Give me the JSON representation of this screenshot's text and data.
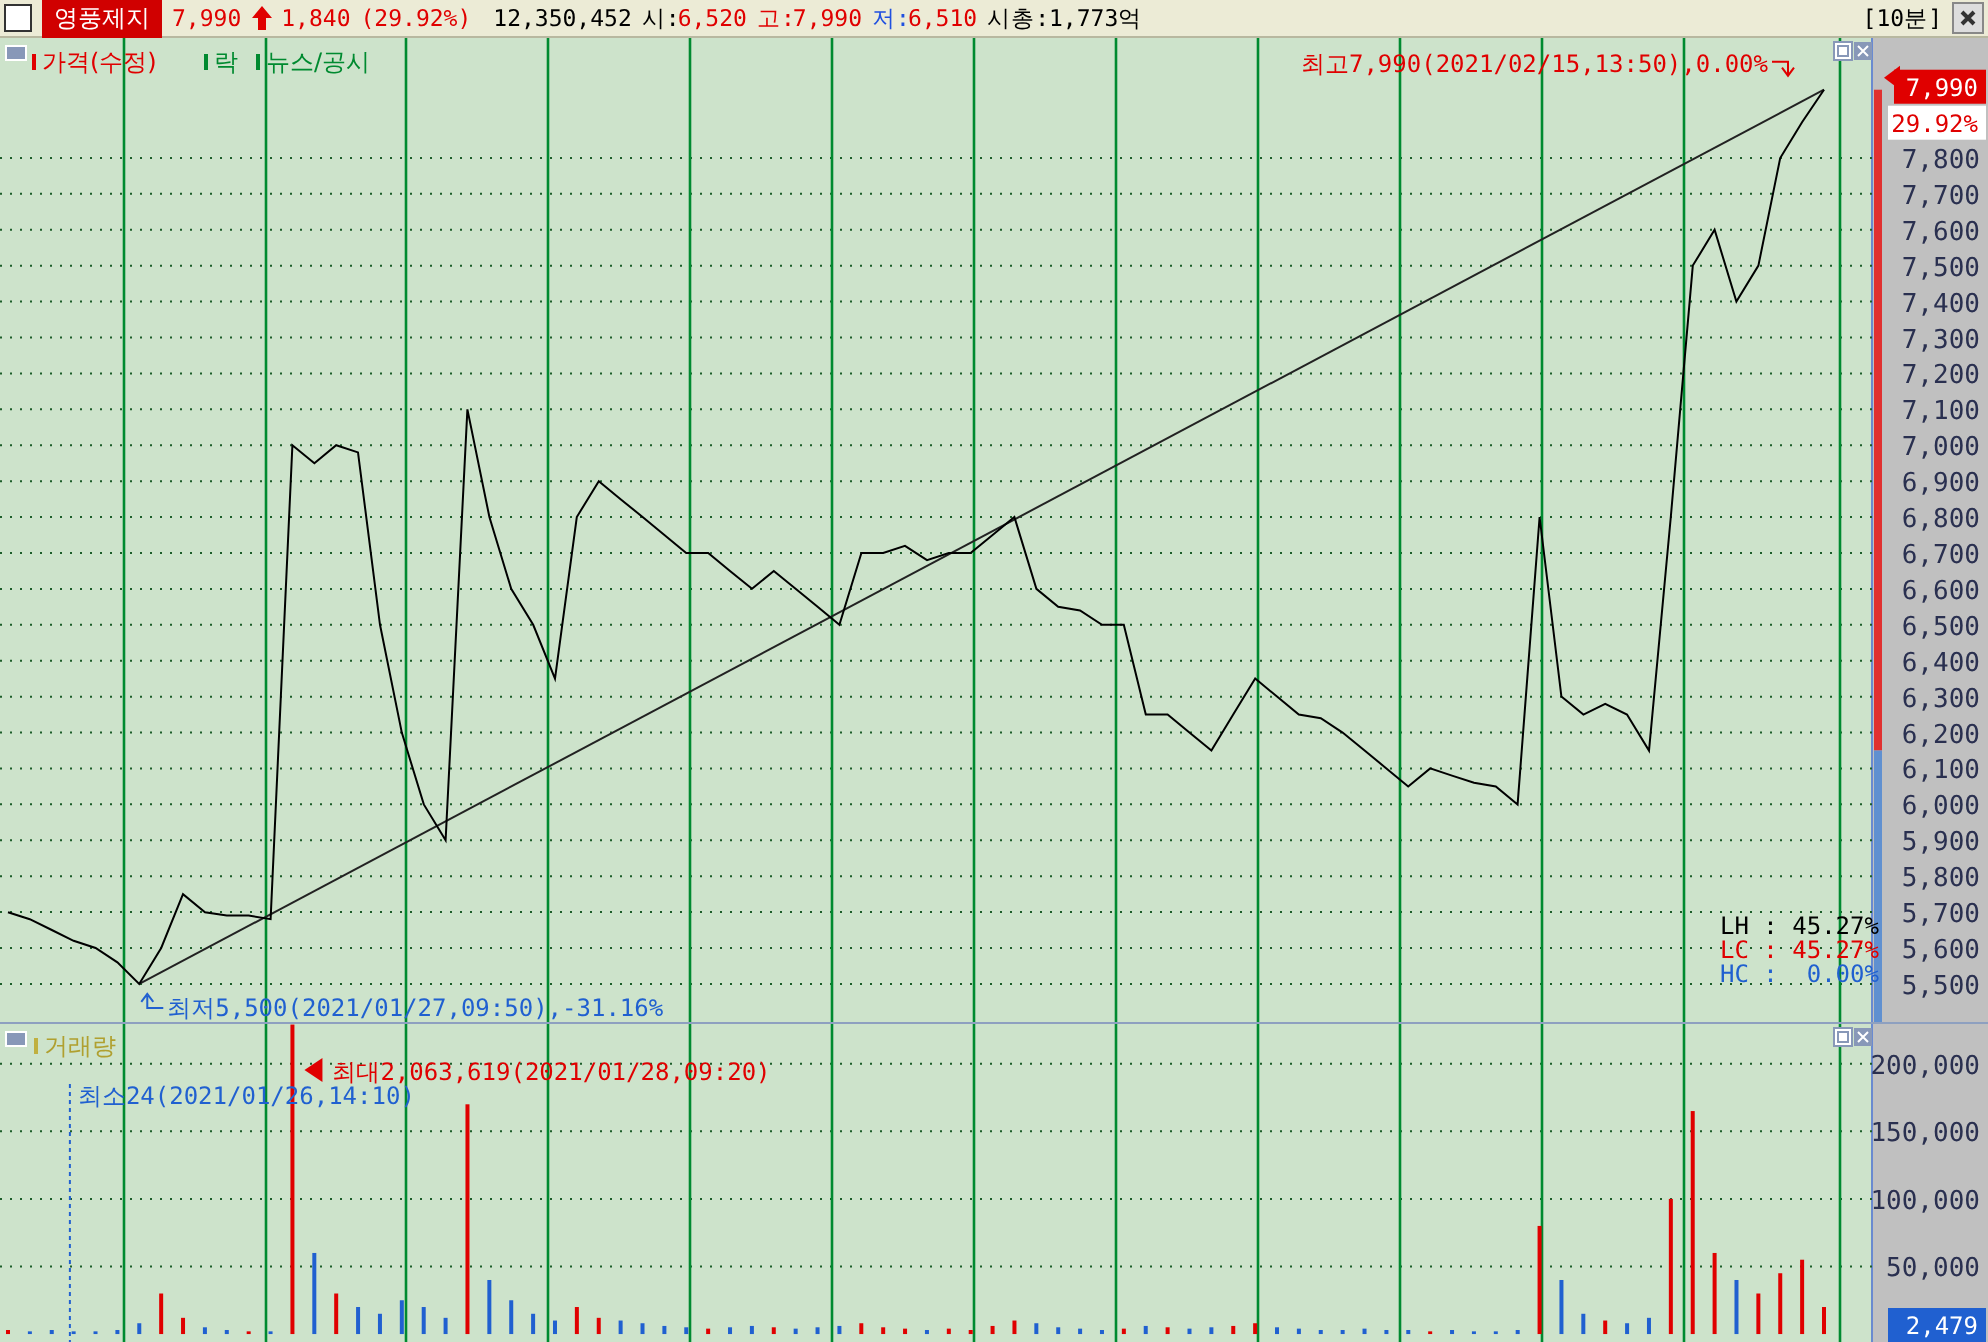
{
  "header": {
    "checkbox": {
      "checked": false
    },
    "stock_name": "영풍제지",
    "price": "7,990",
    "rising": true,
    "change": "1,840",
    "change_rate": "(29.92%)",
    "volume": "12,350,452",
    "quotes": [
      {
        "label": "시:",
        "value": "6,520",
        "color": "#000000"
      },
      {
        "label": "고:",
        "value": "7,990",
        "color": "#e00000"
      },
      {
        "label": "저:",
        "value": "6,510",
        "color": "#2050e0"
      }
    ],
    "market_cap": "시총:1,773억",
    "period": "[10분]"
  },
  "price_panel": {
    "legend": [
      {
        "label": "가격(수정)",
        "color": "#e00000"
      },
      {
        "label": "락",
        "color": "#008a30"
      },
      {
        "label": "뉴스/공시",
        "color": "#008a30"
      }
    ],
    "price_badge": "7,990",
    "rate_badge": "29.92%",
    "high_note": "최고7,990(2021/02/15,13:50),0.00%",
    "low_note": "최저5,500(2021/01/27,09:50),-31.16%",
    "stats": [
      {
        "text": "LH : 45.27%",
        "color": "#000000"
      },
      {
        "text": "LC : 45.27%",
        "color": "#e00000"
      },
      {
        "text": "HC :  0.00%",
        "color": "#2060d0"
      }
    ],
    "chart_data": {
      "type": "line",
      "grid": true,
      "ylim": [
        5394,
        8134
      ],
      "yticks": [
        {
          "value": 5500,
          "label": "5,500"
        },
        {
          "value": 5600,
          "label": "5,600"
        },
        {
          "value": 5700,
          "label": "5,700"
        },
        {
          "value": 5800,
          "label": "5,800"
        },
        {
          "value": 5900,
          "label": "5,900"
        },
        {
          "value": 6000,
          "label": "6,000"
        },
        {
          "value": 6100,
          "label": "6,100"
        },
        {
          "value": 6200,
          "label": "6,200"
        },
        {
          "value": 6300,
          "label": "6,300"
        },
        {
          "value": 6400,
          "label": "6,400"
        },
        {
          "value": 6500,
          "label": "6,500"
        },
        {
          "value": 6600,
          "label": "6,600"
        },
        {
          "value": 6700,
          "label": "6,700"
        },
        {
          "value": 6800,
          "label": "6,800"
        },
        {
          "value": 6900,
          "label": "6,900"
        },
        {
          "value": 7000,
          "label": "7,000"
        },
        {
          "value": 7100,
          "label": "7,100"
        },
        {
          "value": 7200,
          "label": "7,200"
        },
        {
          "value": 7300,
          "label": "7,300"
        },
        {
          "value": 7400,
          "label": "7,400"
        },
        {
          "value": 7500,
          "label": "7,500"
        },
        {
          "value": 7600,
          "label": "7,600"
        },
        {
          "value": 7700,
          "label": "7,700"
        },
        {
          "value": 7800,
          "label": "7,800"
        }
      ],
      "series": [
        {
          "color": "#000000",
          "values": [
            5700,
            5680,
            5650,
            5620,
            5600,
            5560,
            5500,
            5600,
            5750,
            5700,
            5690,
            5690,
            5680,
            7000,
            6950,
            7000,
            6980,
            6500,
            6200,
            6000,
            5900,
            7100,
            6800,
            6600,
            6500,
            6350,
            6800,
            6900,
            6850,
            6800,
            6750,
            6700,
            6700,
            6650,
            6600,
            6650,
            6600,
            6550,
            6500,
            6700,
            6700,
            6720,
            6680,
            6700,
            6700,
            6750,
            6800,
            6600,
            6550,
            6540,
            6500,
            6500,
            6250,
            6250,
            6200,
            6150,
            6250,
            6350,
            6300,
            6250,
            6240,
            6200,
            6150,
            6100,
            6050,
            6100,
            6080,
            6060,
            6050,
            6000,
            6800,
            6300,
            6250,
            6280,
            6250,
            6150,
            6800,
            7500,
            7600,
            7400,
            7500,
            7800,
            7900,
            7990
          ]
        }
      ]
    }
  },
  "volume_panel": {
    "legend": "거래량",
    "max_note": "최대2,063,619(2021/01/28,09:20)",
    "min_note": "최소24(2021/01/26,14:10)",
    "last_badge": "2,479",
    "chart_data": {
      "type": "bar",
      "grid": true,
      "ylim": [
        -5882,
        229412
      ],
      "yticks": [
        {
          "value": 50000,
          "label": "50,000"
        },
        {
          "value": 100000,
          "label": "100,000"
        },
        {
          "value": 150000,
          "label": "150,000"
        },
        {
          "value": 200000,
          "label": "200,000"
        }
      ],
      "series": [
        {
          "values": [
            3000,
            2000,
            3000,
            2000,
            2000,
            3000,
            8000,
            30000,
            12000,
            5000,
            3000,
            2000,
            2000,
            229000,
            60000,
            30000,
            20000,
            15000,
            25000,
            20000,
            12000,
            170000,
            40000,
            25000,
            15000,
            10000,
            20000,
            12000,
            10000,
            8000,
            6000,
            5000,
            4000,
            5000,
            6000,
            5000,
            4000,
            5000,
            6000,
            8000,
            5000,
            4000,
            3000,
            4000,
            3000,
            6000,
            10000,
            8000,
            5000,
            4000,
            3000,
            4000,
            6000,
            5000,
            4000,
            5000,
            6000,
            8000,
            5000,
            4000,
            3000,
            3000,
            4000,
            3000,
            3000,
            2000,
            3000,
            2000,
            2000,
            3000,
            80000,
            40000,
            15000,
            10000,
            8000,
            12000,
            100000,
            165000,
            60000,
            40000,
            30000,
            45000,
            55000,
            20000
          ]
        }
      ]
    }
  }
}
